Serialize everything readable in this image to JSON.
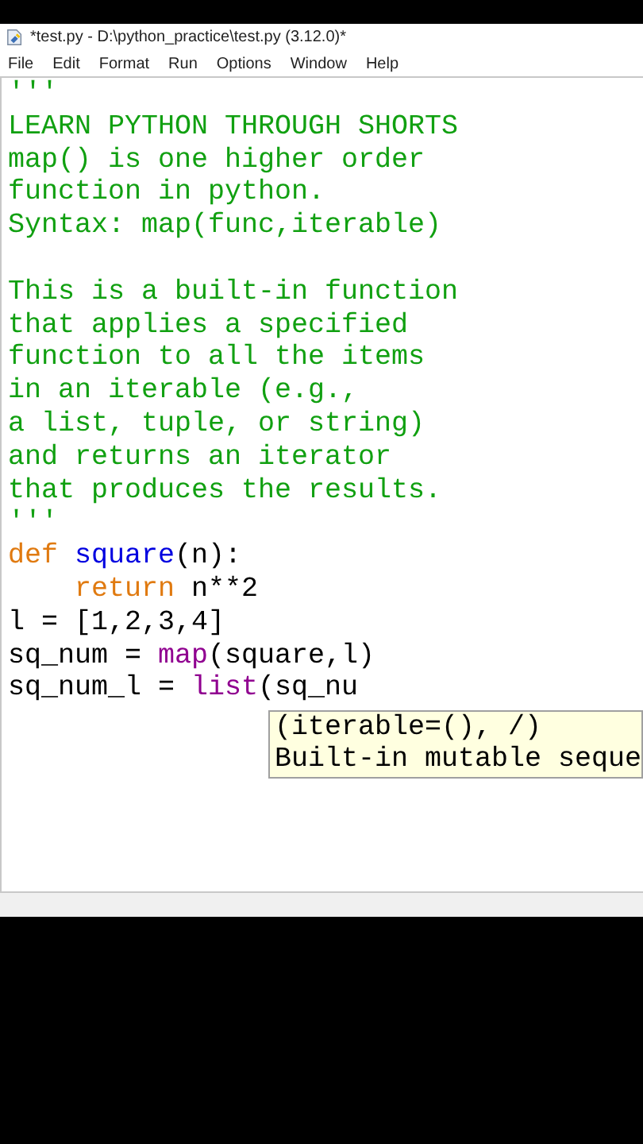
{
  "window": {
    "title": "*test.py - D:\\python_practice\\test.py (3.12.0)*"
  },
  "menu": [
    "File",
    "Edit",
    "Format",
    "Run",
    "Options",
    "Window",
    "Help"
  ],
  "editor": {
    "lines": [
      {
        "kind": "code",
        "tokens": [
          {
            "text": "'''",
            "kind": "string"
          }
        ]
      },
      {
        "kind": "code",
        "tokens": [
          {
            "text": "LEARN PYTHON THROUGH SHORTS",
            "kind": "string"
          }
        ]
      },
      {
        "kind": "code",
        "tokens": [
          {
            "text": "map() is one higher order",
            "kind": "string"
          }
        ]
      },
      {
        "kind": "code",
        "tokens": [
          {
            "text": "function in python.",
            "kind": "string"
          }
        ]
      },
      {
        "kind": "code",
        "tokens": [
          {
            "text": "Syntax: map(func,iterable)",
            "kind": "string"
          }
        ]
      },
      {
        "kind": "blank"
      },
      {
        "kind": "code",
        "tokens": [
          {
            "text": "This is a built-in function",
            "kind": "string"
          }
        ]
      },
      {
        "kind": "code",
        "tokens": [
          {
            "text": "that applies a specified",
            "kind": "string"
          }
        ]
      },
      {
        "kind": "code",
        "tokens": [
          {
            "text": "function to all the items",
            "kind": "string"
          }
        ]
      },
      {
        "kind": "code",
        "tokens": [
          {
            "text": "in an iterable (e.g.,",
            "kind": "string"
          }
        ]
      },
      {
        "kind": "code",
        "tokens": [
          {
            "text": "a list, tuple, or string)",
            "kind": "string"
          }
        ]
      },
      {
        "kind": "code",
        "tokens": [
          {
            "text": "and returns an iterator",
            "kind": "string"
          }
        ]
      },
      {
        "kind": "code",
        "tokens": [
          {
            "text": "that produces the results.",
            "kind": "string"
          }
        ]
      },
      {
        "kind": "code",
        "tokens": [
          {
            "text": "'''",
            "kind": "string"
          }
        ]
      },
      {
        "kind": "code",
        "tokens": [
          {
            "text": "def",
            "kind": "keyword"
          },
          {
            "text": " square",
            "kind": "definition"
          },
          {
            "text": "(n):",
            "kind": "plain"
          }
        ]
      },
      {
        "kind": "code",
        "tokens": [
          {
            "text": "    return",
            "kind": "keyword"
          },
          {
            "text": " n**2",
            "kind": "plain"
          }
        ]
      },
      {
        "kind": "code",
        "tokens": [
          {
            "text": "l = [1,2,3,4]",
            "kind": "plain"
          }
        ]
      },
      {
        "kind": "code",
        "tokens": [
          {
            "text": "sq_num = ",
            "kind": "plain"
          },
          {
            "text": "map",
            "kind": "builtin"
          },
          {
            "text": "(square,l)",
            "kind": "plain"
          }
        ]
      },
      {
        "kind": "code",
        "tokens": [
          {
            "text": "sq_num_l = ",
            "kind": "plain"
          },
          {
            "text": "list",
            "kind": "builtin"
          },
          {
            "text": "(sq_nu",
            "kind": "plain"
          }
        ]
      }
    ],
    "calltip": [
      "(iterable=(), /)",
      "Built-in mutable seque"
    ]
  }
}
